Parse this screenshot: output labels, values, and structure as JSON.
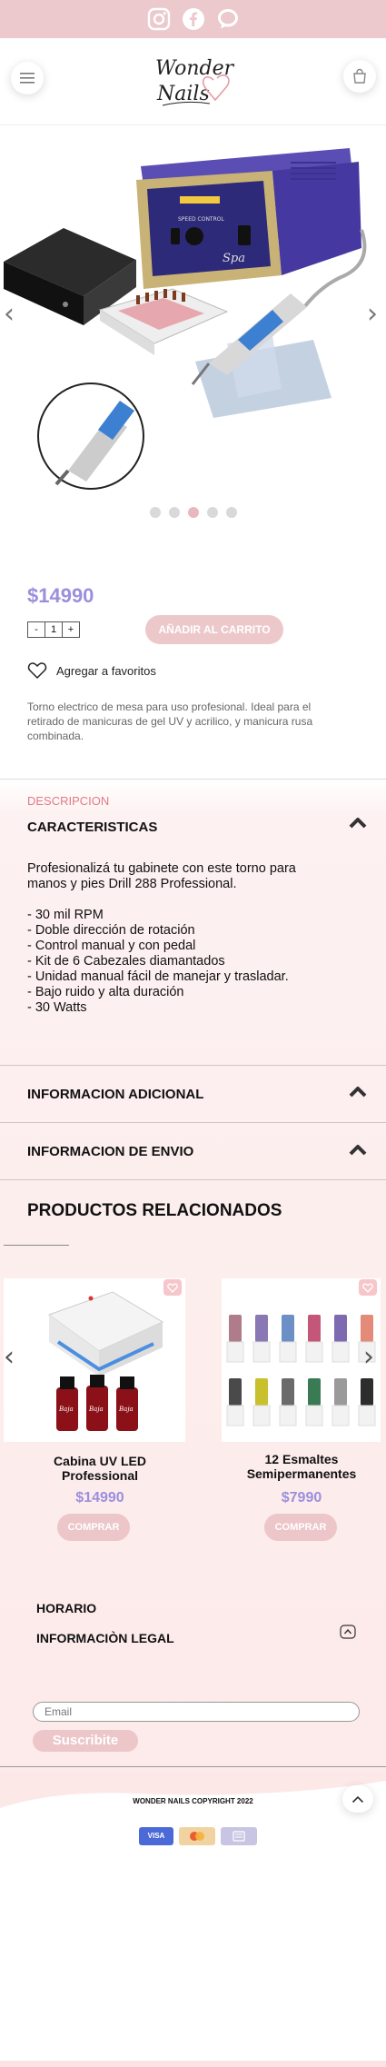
{
  "social": {
    "icons": [
      "instagram-icon",
      "facebook-icon",
      "chat-bubble-icon"
    ]
  },
  "header": {
    "menu_icon": "hamburger-icon",
    "bag_icon": "shopping-bag-icon",
    "logo_line1": "Wonder",
    "logo_line2": "Nails"
  },
  "product": {
    "image_panel_label": "SPEED CONTROL",
    "image_brand": "Spa",
    "price": "$14990",
    "quantity": "1",
    "qty_minus": "-",
    "qty_plus": "+",
    "add_to_cart": "AÑADIR AL CARRITO",
    "favorite": "Agregar a favoritos",
    "description": "Torno electrico de mesa para uso profesional. Ideal para el retirado de manicuras de gel UV y acrilico, y manicura rusa combinada.",
    "carousel_dots": 5,
    "active_dot": 2
  },
  "details": {
    "label": "DESCRIPCION",
    "characteristics_title": "CARACTERISTICAS",
    "characteristics_text": "Profesionalizá tu gabinete con este torno para manos y pies Drill 288 Professional.\n\n- 30 mil RPM\n- Doble dirección de rotación\n- Control manual y con pedal\n- Kit de 6 Cabezales diamantados\n- Unidad manual fácil de manejar y trasladar.\n- Bajo ruido y alta duración\n- 30 Watts",
    "additional_info": "INFORMACION ADICIONAL",
    "shipping_info": "INFORMACION DE ENVIO"
  },
  "related": {
    "title": "PRODUCTOS RELACIONADOS",
    "items": [
      {
        "name": "Cabina UV LED Professional",
        "price": "$14990",
        "button": "COMPRAR",
        "bottle_label": "Baja"
      },
      {
        "name": "12 Esmaltes Semipermanentes",
        "price": "$7990",
        "button": "COMPRAR"
      }
    ]
  },
  "footer": {
    "schedule": "HORARIO",
    "legal": "INFORMACIÒN LEGAL",
    "email_placeholder": "Email",
    "subscribe": "Suscribite",
    "copyright": "WONDER NAILS  COPYRIGHT 2022",
    "payments": [
      "VISA",
      "",
      ""
    ]
  },
  "colors": {
    "top_bar": "#ebc9cc",
    "price_purple": "#9b8fdc",
    "accent_pink": "#e07a86",
    "button_pink": "#edc8cb"
  }
}
